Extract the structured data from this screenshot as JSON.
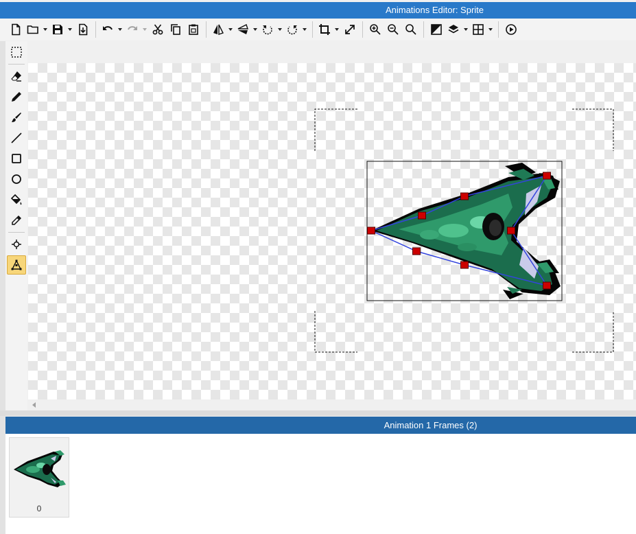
{
  "window": {
    "title": "Animations Editor: Sprite"
  },
  "toolbar": {
    "new": "new-file-icon",
    "open": "open-folder-icon",
    "save": "save-icon",
    "export": "export-icon",
    "undo": "undo-icon",
    "redo": "redo-icon",
    "cut": "cut-icon",
    "copy": "copy-icon",
    "paste": "paste-icon",
    "flip_h": "flip-horizontal-icon",
    "flip_v": "flip-vertical-icon",
    "rotate_ccw": "rotate-ccw-icon",
    "rotate_cw": "rotate-cw-icon",
    "crop": "crop-icon",
    "resize": "resize-icon",
    "zoom_in": "zoom-in-icon",
    "zoom_out": "zoom-out-icon",
    "zoom_reset": "zoom-reset-icon",
    "mask": "mask-icon",
    "layers": "layers-icon",
    "grid": "grid-icon",
    "play": "play-icon"
  },
  "tools": [
    "select",
    "eraser",
    "pencil",
    "brush",
    "line",
    "rectangle",
    "ellipse",
    "fill",
    "eyedropper",
    "origin",
    "polygon-mask"
  ],
  "active_tool": "polygon-mask",
  "frames": {
    "title": "Animation 1 Frames (2)",
    "items": [
      {
        "index": "0"
      }
    ]
  },
  "colors": {
    "titlebar": "#2979c9",
    "frames_header": "#2468a8",
    "handle": "#cc0000",
    "polygon": "#3344dd"
  }
}
